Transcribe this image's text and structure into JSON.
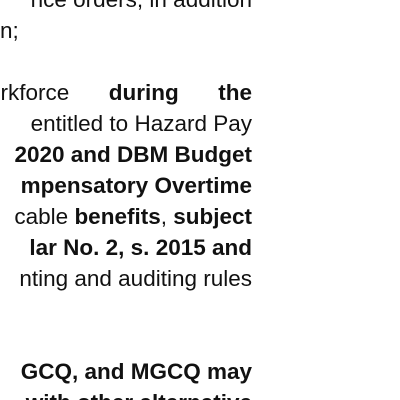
{
  "document": {
    "paragraph_1": {
      "line_1": "nce orders, in addition",
      "line_2": "n;"
    },
    "paragraph_2": {
      "line_1_normal": "orkforce ",
      "line_1_bold": "during the",
      "line_2": "entitled to Hazard Pay",
      "line_3_bold": "2020 and DBM Budget",
      "line_4_bold": "mpensatory Overtime",
      "line_5_a": "cable ",
      "line_5_b_bold": "benefits",
      "line_5_c": ", ",
      "line_5_d_bold": "subject",
      "line_6_bold": "lar No. 2, s. 2015 and",
      "line_7": "nting and auditing rules"
    },
    "paragraph_3": {
      "line_1_bold": "GCQ, and MGCQ may",
      "line_2_bold": "with other alternative"
    }
  }
}
